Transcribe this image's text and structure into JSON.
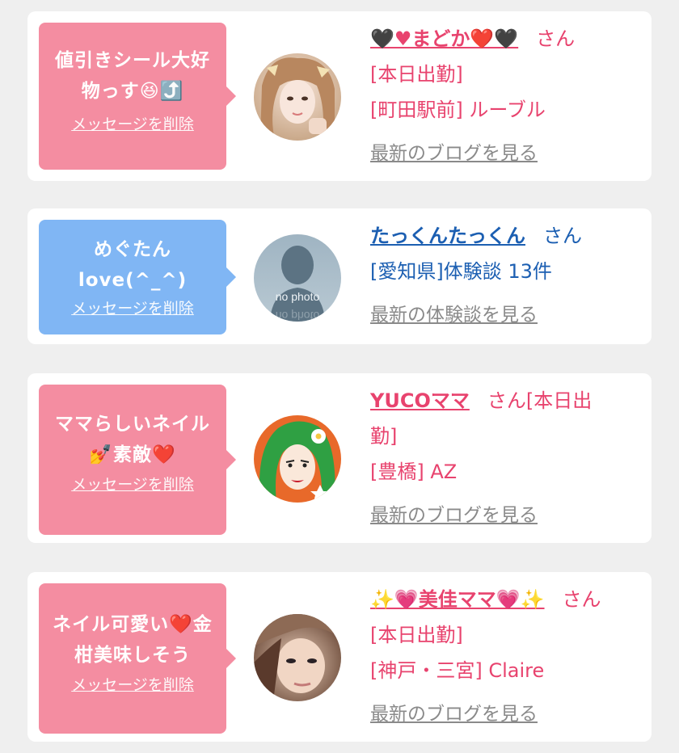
{
  "cards": [
    {
      "bubble_color": "#f48da1",
      "message": "値引きシール大好物っす😆⤴️",
      "delete_label": "メッセージを削除",
      "name": "🖤♥まどか❤️🖤",
      "honorific": "さん",
      "status": "[本日出勤]",
      "location": "[町田駅前] ルーブル",
      "more_label": "最新のブログを見る"
    },
    {
      "bubble_color": "#80b6f4",
      "message": "めぐたん\nlove(^_^)",
      "delete_label": "メッセージを削除",
      "name": "たっくんたっくん",
      "honorific": "さん",
      "location": "[愛知県]体験談 13件",
      "more_label": "最新の体験談を見る",
      "avatar_text": "no photo"
    },
    {
      "bubble_color": "#f48da1",
      "message": "ママらしいネイル💅素敵❤️",
      "delete_label": "メッセージを削除",
      "name": "YUCOママ",
      "honorific": "さん[本日出",
      "honorific_cont": "勤]",
      "location": "[豊橋] AZ",
      "more_label": "最新のブログを見る"
    },
    {
      "bubble_color": "#f48da1",
      "message": "ネイル可愛い❤️金柑美味しそう",
      "delete_label": "メッセージを削除",
      "name": "✨💗美佳ママ💗✨",
      "honorific": "さん",
      "status": "[本日出勤]",
      "location": "[神戸・三宮] Claire",
      "more_label": "最新のブログを見る"
    }
  ]
}
